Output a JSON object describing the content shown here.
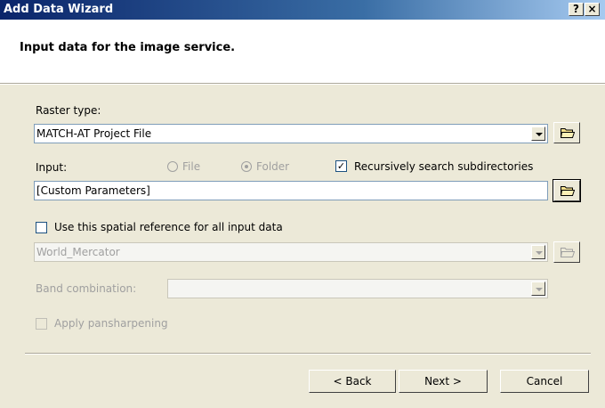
{
  "window": {
    "title": "Add Data Wizard",
    "help_label": "?",
    "close_label": "×"
  },
  "header": {
    "text": "Input data for the image service."
  },
  "raster_type": {
    "label": "Raster type:",
    "value": "MATCH-AT Project File"
  },
  "input": {
    "label": "Input:",
    "file_label": "File",
    "folder_label": "Folder",
    "selected": "Folder",
    "recursive_label": "Recursively search subdirectories",
    "recursive_checked": true,
    "value": "[Custom Parameters]"
  },
  "spatial": {
    "label": "Use this spatial reference for all input data",
    "checked": false,
    "value": "World_Mercator"
  },
  "band": {
    "label": "Band combination:",
    "value": ""
  },
  "pansharpen": {
    "label": "Apply pansharpening",
    "checked": false
  },
  "buttons": {
    "back": "< Back",
    "next": "Next >",
    "cancel": "Cancel"
  },
  "icons": {
    "folder": "folder-open-icon",
    "dropdown": "chevron-down-icon"
  }
}
